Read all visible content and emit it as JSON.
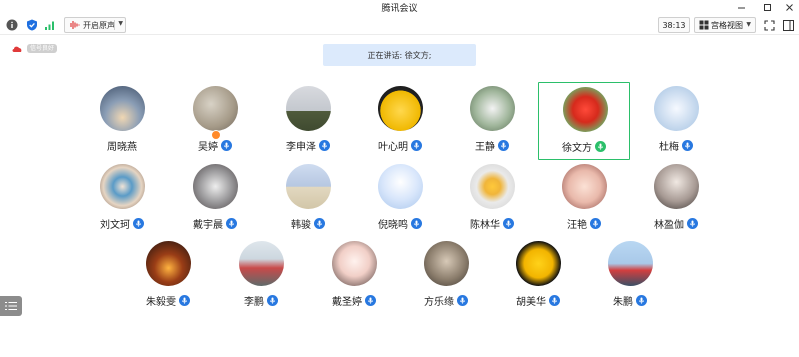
{
  "window": {
    "title": "腾讯会议"
  },
  "toolbar": {
    "noise_label": "开启原声",
    "timer": "38:13",
    "view_label": "宫格视图"
  },
  "network": {
    "latency": "信号良好"
  },
  "banner": {
    "speaking_text": "正在讲话: 徐文方;"
  },
  "colors": {
    "accent_blue": "#2878e0",
    "speaking_green": "#2bbf6a",
    "banner_bg": "#dceafc"
  },
  "participants": [
    {
      "name": "周晓燕",
      "mic": false
    },
    {
      "name": "吴婷",
      "mic": true,
      "host": true
    },
    {
      "name": "李申泽",
      "mic": true
    },
    {
      "name": "叶心明",
      "mic": true
    },
    {
      "name": "王静",
      "mic": true
    },
    {
      "name": "徐文方",
      "mic": true,
      "speaking": true
    },
    {
      "name": "杜梅",
      "mic": true
    },
    {
      "name": "刘文珂",
      "mic": true
    },
    {
      "name": "戴宇晨",
      "mic": true
    },
    {
      "name": "韩骏",
      "mic": true
    },
    {
      "name": "倪晓鸣",
      "mic": true
    },
    {
      "name": "陈林华",
      "mic": true
    },
    {
      "name": "汪艳",
      "mic": true
    },
    {
      "name": "林盈伽",
      "mic": true
    },
    {
      "name": "朱毅雯",
      "mic": true
    },
    {
      "name": "李鹏",
      "mic": true
    },
    {
      "name": "戴圣婷",
      "mic": true
    },
    {
      "name": "方乐缘",
      "mic": true
    },
    {
      "name": "胡美华",
      "mic": true
    },
    {
      "name": "朱鹏",
      "mic": true
    }
  ]
}
